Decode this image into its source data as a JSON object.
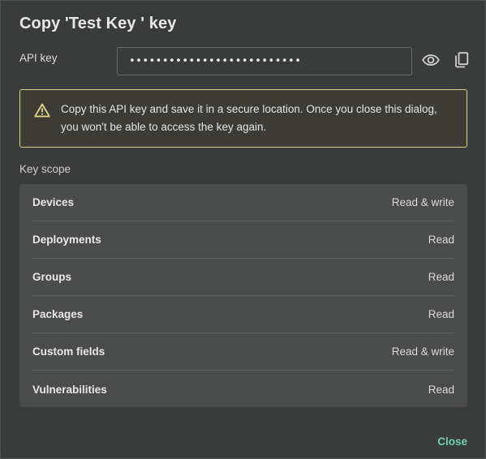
{
  "dialog": {
    "title": "Copy 'Test Key ' key",
    "api_key_label": "API key",
    "api_key_value": "••••••••••••••••••••••••••",
    "show_icon": "eye-icon",
    "copy_icon": "copy-icon",
    "warning": {
      "icon": "warning-icon",
      "text": "Copy this API key and save it in a secure location. Once you close this dialog, you won't be able to access the key again."
    },
    "scope_label": "Key scope",
    "scopes": [
      {
        "name": "Devices",
        "value": "Read & write"
      },
      {
        "name": "Deployments",
        "value": "Read"
      },
      {
        "name": "Groups",
        "value": "Read"
      },
      {
        "name": "Packages",
        "value": "Read"
      },
      {
        "name": "Custom fields",
        "value": "Read & write"
      },
      {
        "name": "Vulnerabilities",
        "value": "Read"
      }
    ],
    "close_label": "Close"
  },
  "colors": {
    "background": "#3a3b3b",
    "warning_border": "#d8cf8c",
    "accent": "#6fd0ae",
    "scope_panel": "#4a4b4b"
  }
}
